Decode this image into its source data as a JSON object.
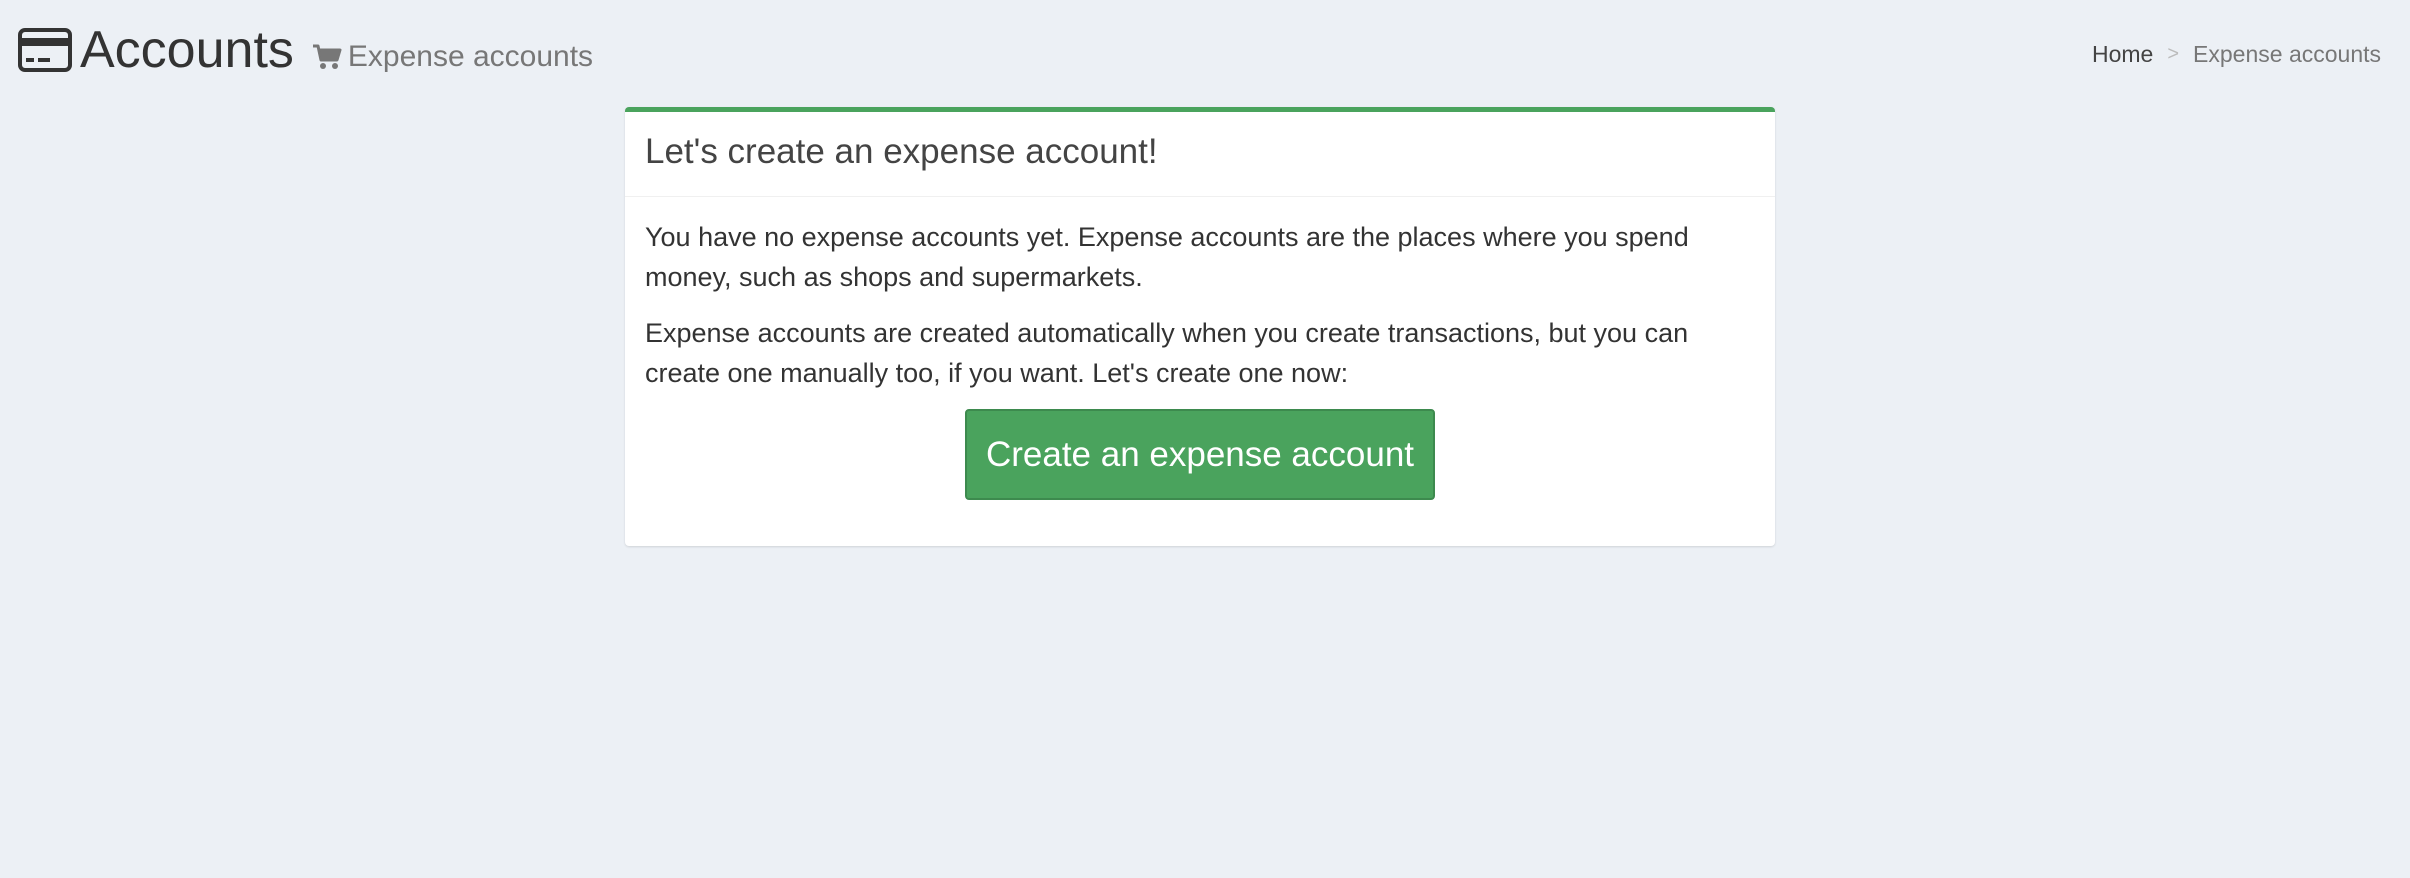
{
  "header": {
    "title": "Accounts",
    "title_icon": "credit-card-icon",
    "subtitle": "Expense accounts",
    "subtitle_icon": "shopping-cart-icon"
  },
  "breadcrumb": {
    "home": "Home",
    "separator": ">",
    "current": "Expense accounts"
  },
  "box": {
    "title": "Let's create an expense account!",
    "paragraph1": "You have no expense accounts yet. Expense accounts are the places where you spend money, such as shops and supermarkets.",
    "paragraph2": "Expense accounts are created automatically when you create transactions, but you can create one manually too, if you want. Let's create one now:",
    "button_label": "Create an expense account",
    "accent_color": "#4aa35d"
  }
}
